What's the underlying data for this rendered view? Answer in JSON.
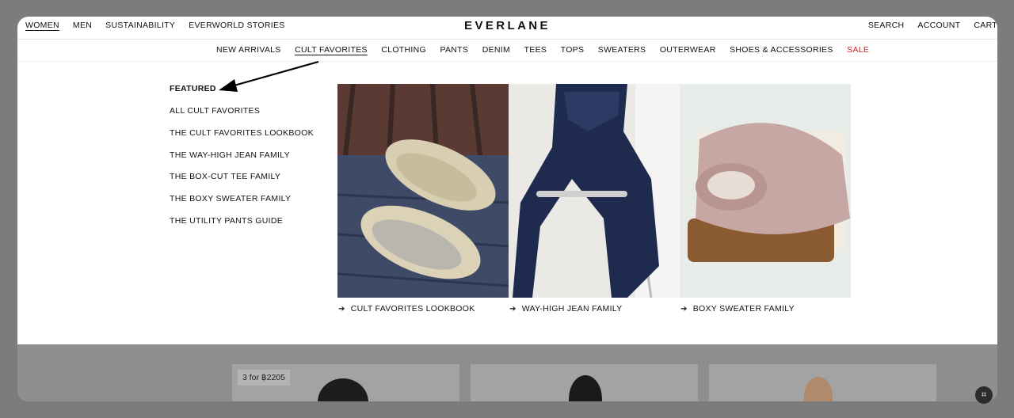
{
  "header": {
    "left_nav": [
      "WOMEN",
      "MEN",
      "SUSTAINABILITY",
      "EVERWORLD STORIES"
    ],
    "logo": "EVERLANE",
    "right_nav": [
      "SEARCH",
      "ACCOUNT",
      "CART"
    ]
  },
  "category_nav": [
    "NEW ARRIVALS",
    "CULT FAVORITES",
    "CLOTHING",
    "PANTS",
    "DENIM",
    "TEES",
    "TOPS",
    "SWEATERS",
    "OUTERWEAR",
    "SHOES & ACCESSORIES",
    "SALE"
  ],
  "active_category": "CULT FAVORITES",
  "featured": {
    "title": "FEATURED",
    "links": [
      "ALL CULT FAVORITES",
      "THE CULT FAVORITES LOOKBOOK",
      "THE WAY-HIGH JEAN FAMILY",
      "THE BOX-CUT TEE FAMILY",
      "THE BOXY SWEATER FAMILY",
      "THE UTILITY PANTS GUIDE"
    ]
  },
  "cards": [
    {
      "caption": "CULT FAVORITES LOOKBOOK",
      "icon": "arrow-right-icon"
    },
    {
      "caption": "WAY-HIGH JEAN FAMILY",
      "icon": "arrow-right-icon"
    },
    {
      "caption": "BOXY SWEATER FAMILY",
      "icon": "arrow-right-icon"
    }
  ],
  "products": {
    "badge": "3 for ฿2205"
  },
  "colors": {
    "sale": "#c81e1e",
    "backdrop": "#7c7c7c"
  }
}
